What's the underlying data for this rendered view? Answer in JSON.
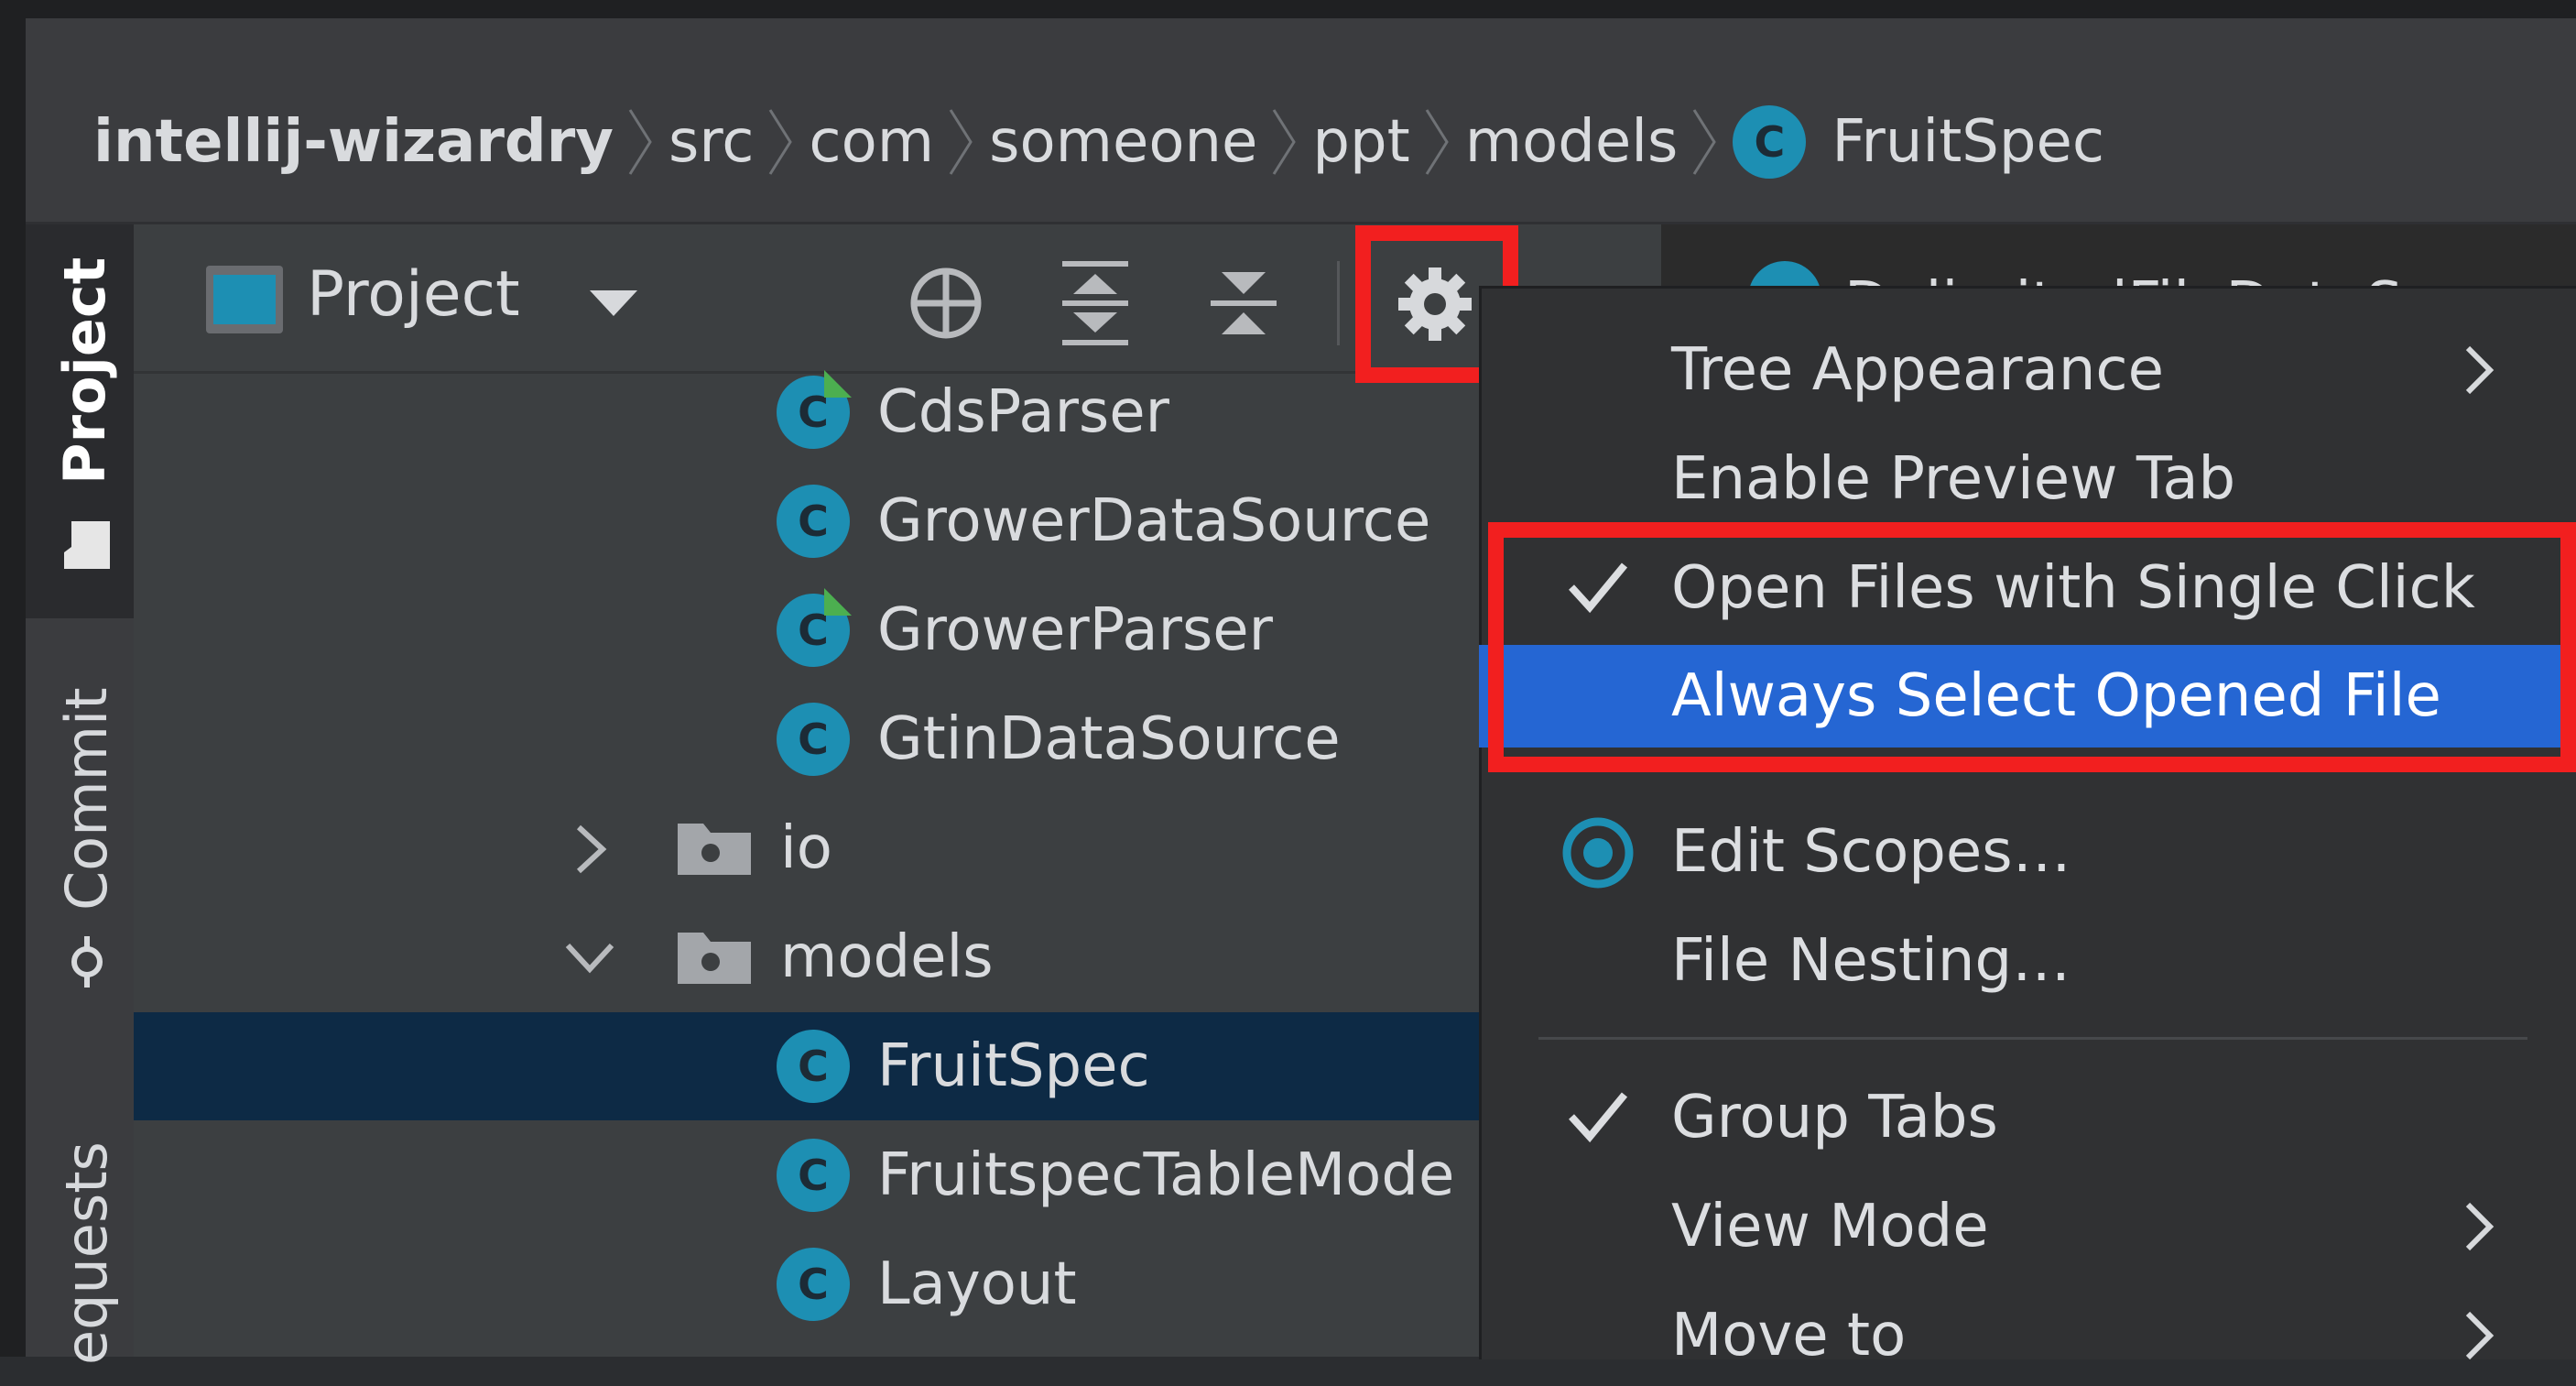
{
  "breadcrumb": {
    "items": [
      "intellij-wizardry",
      "src",
      "com",
      "someone",
      "ppt",
      "models"
    ],
    "current_file": "FruitSpec",
    "class_icon_letter": "C"
  },
  "tool_window_tabs": {
    "project": "Project",
    "commit": "Commit",
    "requests": "equests"
  },
  "project_panel": {
    "title": "Project",
    "tree": {
      "cds_parser": "CdsParser",
      "grower_data_source": "GrowerDataSource",
      "grower_parser": "GrowerParser",
      "gtin_data_source": "GtinDataSource",
      "io_folder": "io",
      "models_folder": "models",
      "fruit_spec": "FruitSpec",
      "fruitspec_table_model": "FruitspecTableMode",
      "layout": "Layout"
    }
  },
  "editor": {
    "tab_partial": "DelimitedFileDataSource"
  },
  "options_menu": {
    "tree_appearance": "Tree Appearance",
    "enable_preview_tab": "Enable Preview Tab",
    "open_files_single_click": "Open Files with Single Click",
    "always_select_opened_file": "Always Select Opened File",
    "edit_scopes": "Edit Scopes…",
    "file_nesting": "File Nesting…",
    "group_tabs": "Group Tabs",
    "view_mode": "View Mode",
    "move_to": "Move to"
  },
  "colors": {
    "highlight_red": "#f21f1f",
    "menu_selection": "#2566d3",
    "class_icon": "#1d8fb3",
    "selected_row": "#0d2a45"
  }
}
